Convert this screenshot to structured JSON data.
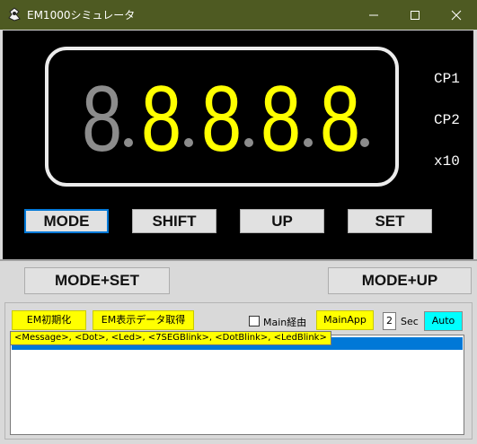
{
  "window": {
    "title": "EM1000シミュレータ",
    "controls": [
      "minimize-icon",
      "maximize-icon",
      "close-icon"
    ],
    "titlebar_color": "#4e5a22"
  },
  "display": {
    "digits": [
      {
        "char": "8",
        "lit": false
      },
      {
        "char": "8",
        "lit": true
      },
      {
        "char": "8",
        "lit": true
      },
      {
        "char": "8",
        "lit": true
      },
      {
        "char": "8",
        "lit": true
      }
    ],
    "colors": {
      "lit": "#ffff00",
      "unlit": "#8c8c8c",
      "background": "#000000"
    },
    "indicators": [
      "CP1",
      "CP2",
      "x10"
    ]
  },
  "panel_buttons": [
    "MODE",
    "SHIFT",
    "UP",
    "SET"
  ],
  "combo_buttons": {
    "mode_set": "MODE+SET",
    "mode_up": "MODE+UP"
  },
  "controls": {
    "init_button": "EM初期化",
    "fetch_button": "EM表示データ取得",
    "main_checkbox_label": "Main経由",
    "main_checkbox_checked": false,
    "mainapp_button": "MainApp",
    "seconds_value": "2",
    "seconds_label": "Sec",
    "auto_button": "Auto"
  },
  "tooltip": "<Message>, <Dot>, <Led>, <7SEGBlink>, <DotBlink>, <LedBlink>",
  "log": {
    "selected_row": ""
  }
}
